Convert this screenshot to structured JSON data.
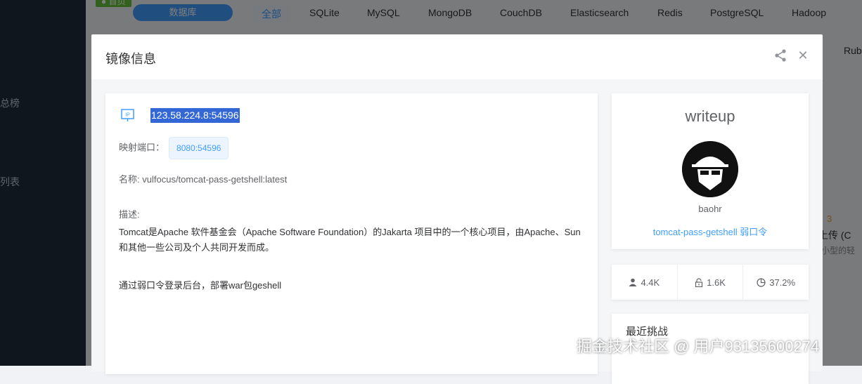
{
  "background": {
    "sidebar": {
      "item_a": "总榜",
      "item_b": "列表"
    },
    "home_tag": "● 首页",
    "database_button": "数据库",
    "tabs": [
      "全部",
      "SQLite",
      "MySQL",
      "MongoDB",
      "CouchDB",
      "Elasticsearch",
      "Redis",
      "PostgreSQL",
      "Hadoop"
    ],
    "right_fragments": {
      "rub": "Rub",
      "three": "3",
      "upload": "上传 (C",
      "small": "小型的轻"
    }
  },
  "dialog": {
    "title": "镜像信息",
    "ip": "123.58.224.8:54596",
    "ip_icon_label": "IP",
    "port_label": "映射端口：",
    "port_value": "8080:54596",
    "name_label": "名称:",
    "name_value": "vulfocus/tomcat-pass-getshell:latest",
    "desc_label": "描述:",
    "desc_line1": "Tomcat是Apache 软件基金会（Apache Software Foundation）的Jakarta 项目中的一个核心项目，由Apache、Sun",
    "desc_line2": "和其他一些公司及个人共同开发而成。",
    "desc_line3": "通过弱口令登录后台，部署war包geshell"
  },
  "author": {
    "title": "writeup",
    "name": "baohr",
    "link": "tomcat-pass-getshell 弱口令"
  },
  "stats": {
    "users": "4.4K",
    "locks": "1.6K",
    "rate": "37.2%"
  },
  "recent": {
    "title": "最近挑战"
  },
  "watermark": "掘金技术社区 @ 用户93135600274",
  "icons": {
    "share": "share-icon",
    "close": "close-icon",
    "ip": "ip-icon",
    "user": "user-icon",
    "lock": "lock-icon",
    "pie": "pie-chart-icon"
  }
}
